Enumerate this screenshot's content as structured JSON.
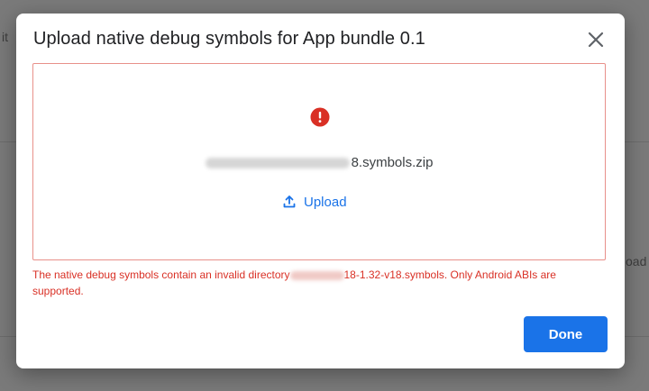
{
  "background": {
    "left_fragment": "it",
    "right_fragment": "oad"
  },
  "dialog": {
    "title": "Upload native debug symbols for App bundle 0.1",
    "file": {
      "name_suffix": "8.symbols.zip"
    },
    "upload_label": "Upload",
    "error": {
      "part1": "The native debug symbols contain an invalid directory",
      "part2": "18-1.32-v18.symbols. Only Android ABIs are supported."
    },
    "done_label": "Done"
  },
  "colors": {
    "accent": "#1a73e8",
    "error": "#d93025",
    "error_border": "#e8908a"
  },
  "icons": {
    "close": "close-icon",
    "error": "error-icon",
    "upload": "upload-icon"
  }
}
